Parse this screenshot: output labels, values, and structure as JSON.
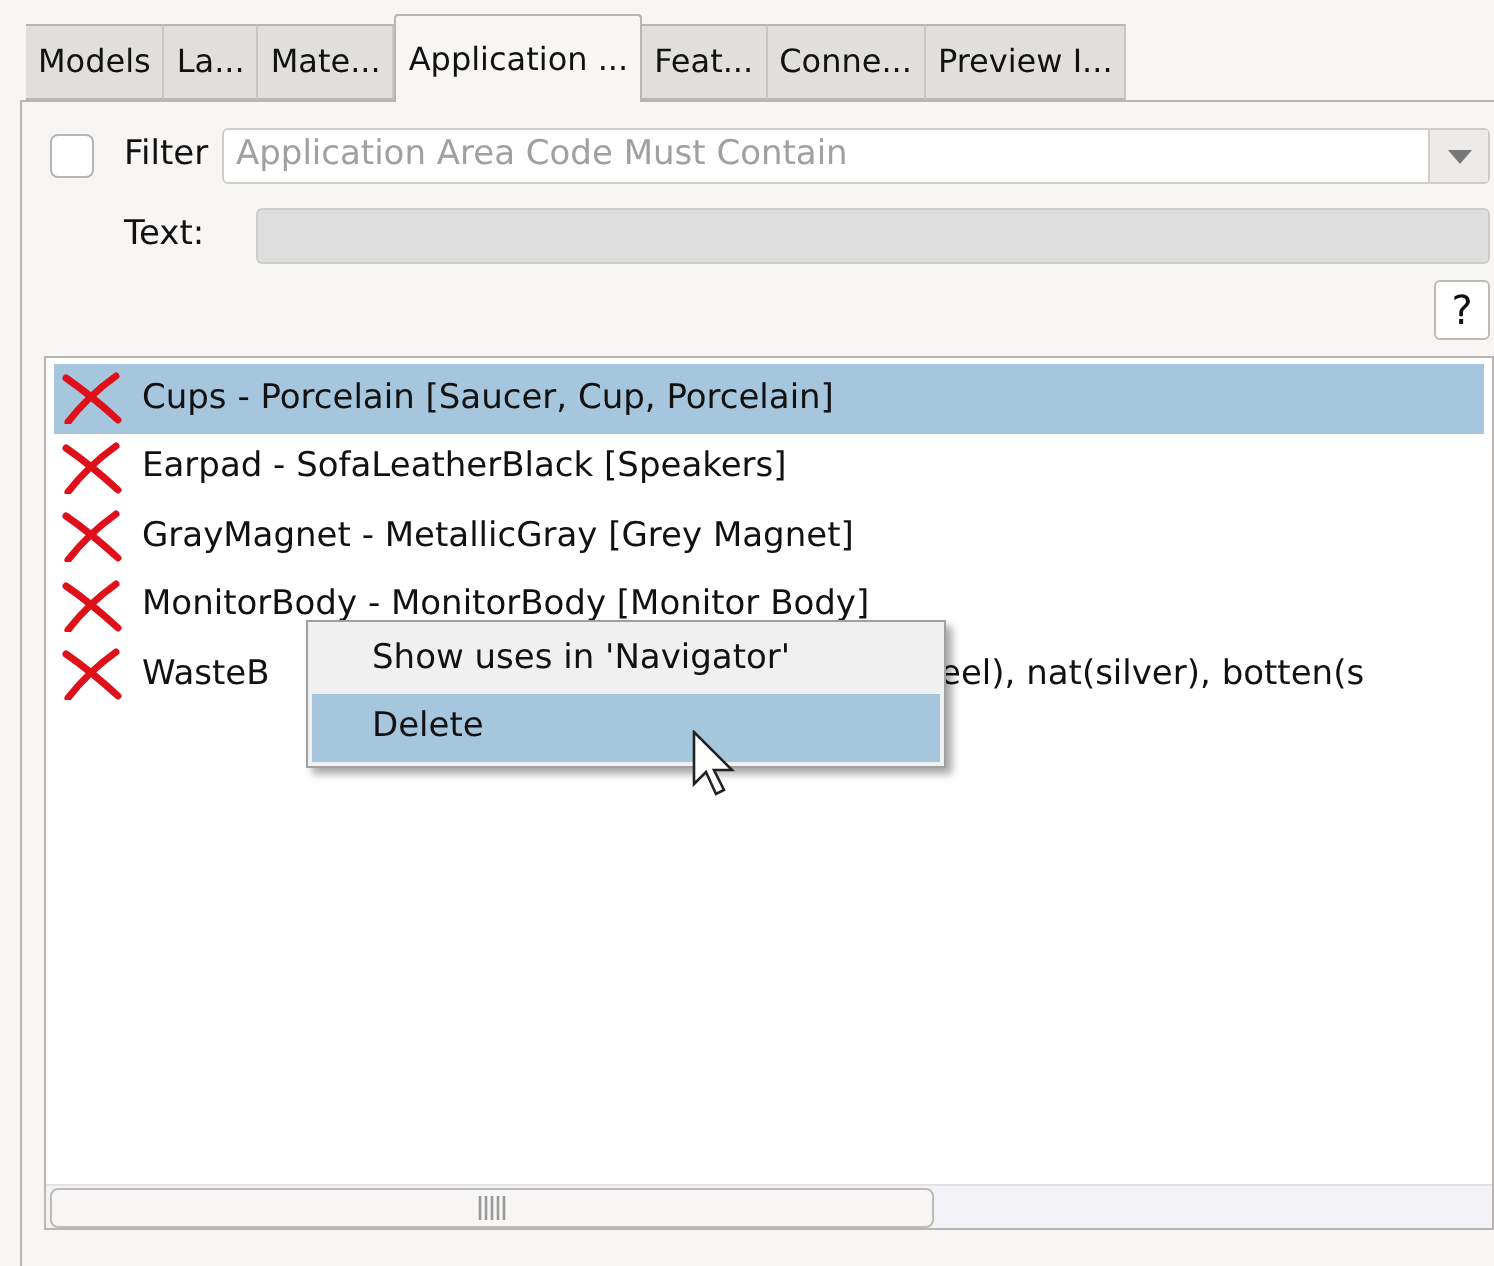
{
  "tabs": [
    {
      "label": "Models",
      "selected": false
    },
    {
      "label": "La...",
      "selected": false
    },
    {
      "label": "Mate...",
      "selected": false
    },
    {
      "label": "Application ...",
      "selected": true
    },
    {
      "label": "Feat...",
      "selected": false
    },
    {
      "label": "Conne...",
      "selected": false
    },
    {
      "label": "Preview I...",
      "selected": false
    }
  ],
  "filter": {
    "label": "Filter",
    "checked": false,
    "placeholder": "Application Area Code Must Contain"
  },
  "text_field": {
    "label": "Text:"
  },
  "help_button": "?",
  "items": [
    {
      "parts": [
        "Cups - Porcelain [Saucer, Cup, Porcelain]"
      ],
      "selected": true
    },
    {
      "parts": [
        "Earpad - SofaLeatherBlack [Speakers]"
      ],
      "selected": false
    },
    {
      "parts": [
        "GrayMagnet - MetallicGray [Grey Magnet]"
      ],
      "selected": false
    },
    {
      "parts": [
        "MonitorBody - MonitorBody [Monitor Body]"
      ],
      "selected": false
    },
    {
      "parts": [
        "WasteB",
        "eel), nat(silver), botten(s"
      ],
      "selected": false
    }
  ],
  "context_menu": [
    {
      "label": "Show uses in 'Navigator'",
      "selected": false
    },
    {
      "label": "Delete",
      "selected": true
    }
  ]
}
